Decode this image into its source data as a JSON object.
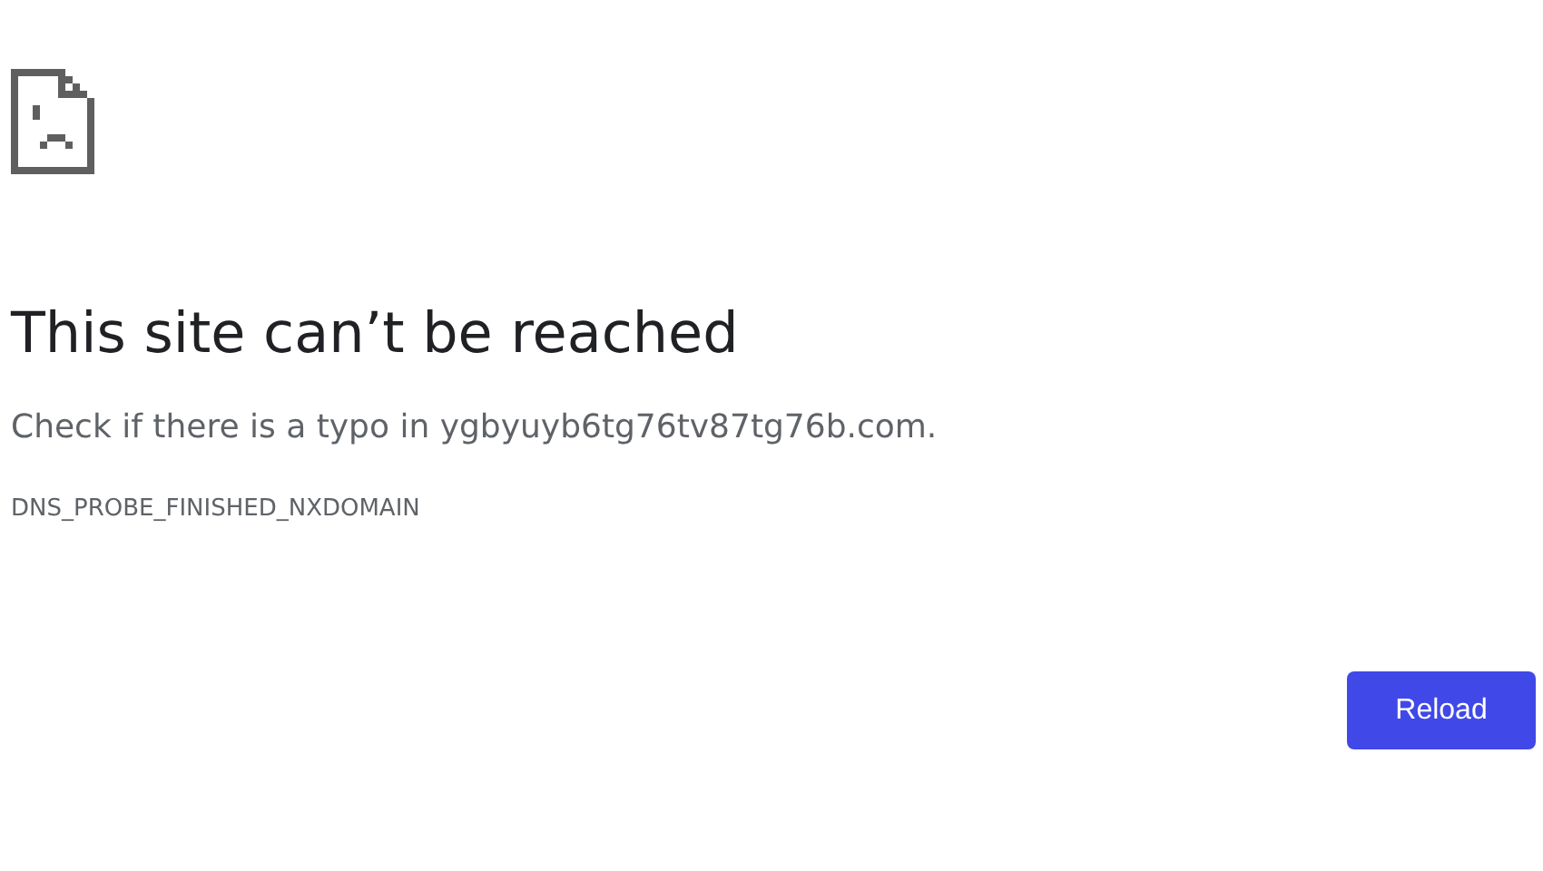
{
  "heading": "This site can’t be reached",
  "message": "Check if there is a typo in ygbyuyb6tg76tv87tg76b.com.",
  "error_code": "DNS_PROBE_FINISHED_NXDOMAIN",
  "buttons": [
    "Reload"
  ]
}
